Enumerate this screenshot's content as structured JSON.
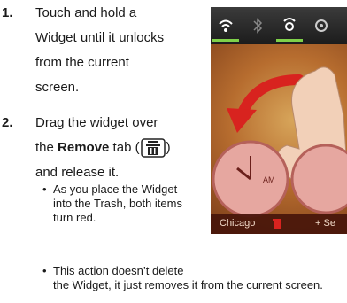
{
  "steps": [
    {
      "number": "1.",
      "lines": [
        "Touch and hold a",
        "Widget until it unlocks",
        "from the current",
        "screen."
      ]
    },
    {
      "number": "2.",
      "line1": "Drag the widget over",
      "line2_prefix": "the ",
      "line2_bold": "Remove",
      "line2_mid": " tab (",
      "line2_suffix": ")",
      "line3": "and release it."
    }
  ],
  "bullets": [
    {
      "lines": [
        "As you place the Widget",
        "into the Trash, both items",
        "turn red."
      ]
    },
    {
      "lines": [
        "This action doesn’t delete",
        "the Widget, it just removes it from the current screen."
      ]
    }
  ],
  "phone": {
    "clock1_label": "AM",
    "taskbar_city": "Chicago",
    "taskbar_settings": "+ Se"
  }
}
